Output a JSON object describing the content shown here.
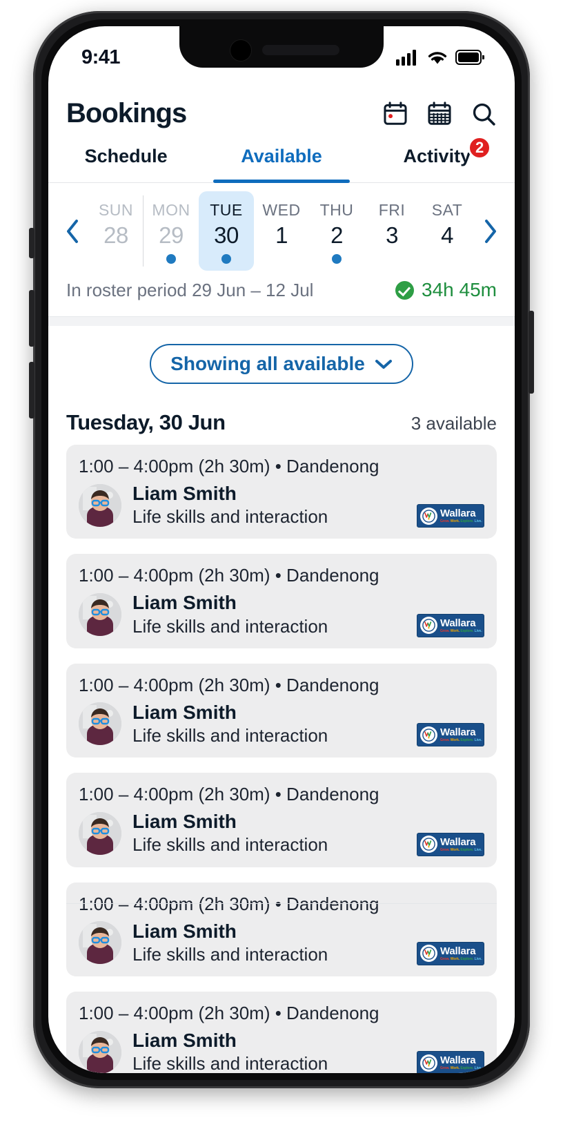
{
  "status_bar": {
    "time": "9:41",
    "icons": [
      "cellular-signal-icon",
      "wifi-icon",
      "battery-icon"
    ]
  },
  "header": {
    "title": "Bookings",
    "actions": [
      {
        "name": "calendar-day-icon"
      },
      {
        "name": "calendar-month-icon"
      },
      {
        "name": "search-icon"
      }
    ]
  },
  "tabs": {
    "items": [
      {
        "label": "Schedule",
        "active": false
      },
      {
        "label": "Available",
        "active": true
      },
      {
        "label": "Activity",
        "active": false,
        "badge": "2"
      }
    ],
    "active_color": "#0f6cbd",
    "badge_color": "#e02020"
  },
  "week_strip": {
    "prev_label": "‹",
    "next_label": "›",
    "days": [
      {
        "name": "SUN",
        "num": "28",
        "past": true,
        "dot": false,
        "selected": false
      },
      {
        "name": "MON",
        "num": "29",
        "past": true,
        "dot": true,
        "selected": false
      },
      {
        "name": "TUE",
        "num": "30",
        "past": false,
        "dot": true,
        "selected": true
      },
      {
        "name": "WED",
        "num": "1",
        "past": false,
        "dot": false,
        "selected": false
      },
      {
        "name": "THU",
        "num": "2",
        "past": false,
        "dot": true,
        "selected": false
      },
      {
        "name": "FRI",
        "num": "3",
        "past": false,
        "dot": false,
        "selected": false
      },
      {
        "name": "SAT",
        "num": "4",
        "past": false,
        "dot": false,
        "selected": false
      }
    ],
    "selected_bg": "#d8ebfb",
    "dot_color": "#1f7ac0"
  },
  "roster": {
    "period_text": "In roster period 29 Jun – 12 Jul",
    "hours": "34h 45m",
    "hours_color": "#1e8e3e",
    "status_icon": "check-circle-icon"
  },
  "filter": {
    "label": "Showing all available",
    "chevron": "chevron-down-icon",
    "color": "#1565a8"
  },
  "day_heading": {
    "title": "Tuesday, 30 Jun",
    "count": "3 available"
  },
  "bookings": [
    {
      "time": "1:00 – 4:00pm (2h 30m) • Dandenong",
      "name": "Liam Smith",
      "role": "Life skills and interaction",
      "logo_word": "Wallara",
      "logo_tagline": "Grow. Work. Explore. Live."
    },
    {
      "time": "1:00 – 4:00pm (2h 30m) • Dandenong",
      "name": "Liam Smith",
      "role": "Life skills and interaction",
      "logo_word": "Wallara",
      "logo_tagline": "Grow. Work. Explore. Live."
    },
    {
      "time": "1:00 – 4:00pm (2h 30m) • Dandenong",
      "name": "Liam Smith",
      "role": "Life skills and interaction",
      "logo_word": "Wallara",
      "logo_tagline": "Grow. Work. Explore. Live."
    },
    {
      "time": "1:00 – 4:00pm (2h 30m) • Dandenong",
      "name": "Liam Smith",
      "role": "Life skills and interaction",
      "logo_word": "Wallara",
      "logo_tagline": "Grow. Work. Explore. Live."
    },
    {
      "time": "1:00 – 4:00pm (2h 30m) • Dandenong",
      "name": "Liam Smith",
      "role": "Life skills and interaction",
      "logo_word": "Wallara",
      "logo_tagline": "Grow. Work. Explore. Live."
    },
    {
      "time": "1:00 – 4:00pm (2h 30m) • Dandenong",
      "name": "Liam Smith",
      "role": "Life skills and interaction",
      "logo_word": "Wallara",
      "logo_tagline": "Grow. Work. Explore. Live."
    }
  ]
}
